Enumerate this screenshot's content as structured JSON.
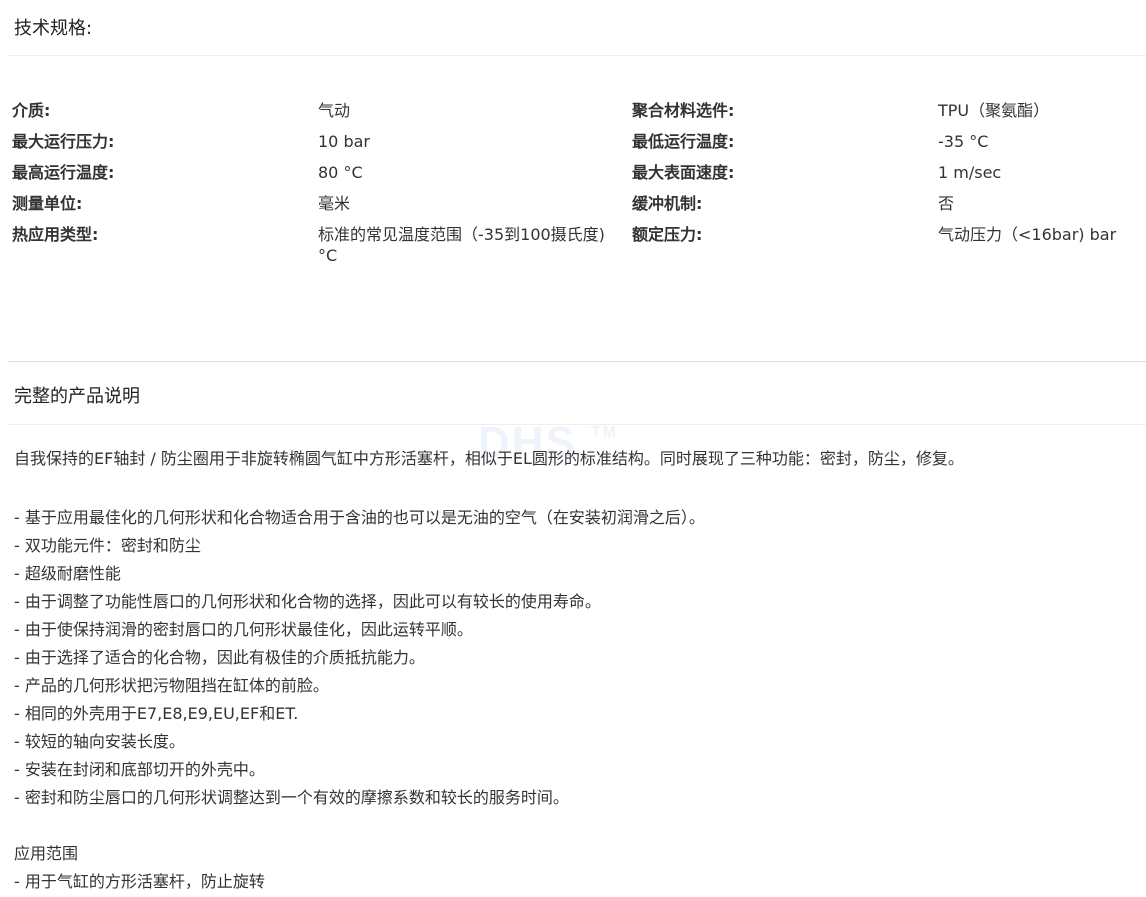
{
  "spec_section": {
    "title": "技术规格:",
    "rows": [
      {
        "label1": "介质:",
        "value1": "气动",
        "label2": "聚合材料选件:",
        "value2": "TPU（聚氨酯）"
      },
      {
        "label1": "最大运行压力:",
        "value1": "10 bar",
        "label2": "最低运行温度:",
        "value2": "-35 °C"
      },
      {
        "label1": "最高运行温度:",
        "value1": "80 °C",
        "label2": "最大表面速度:",
        "value2": "1 m/sec"
      },
      {
        "label1": "测量单位:",
        "value1": "毫米",
        "label2": "缓冲机制:",
        "value2": "否"
      },
      {
        "label1": "热应用类型:",
        "value1": "标准的常见温度范围（-35到100摄氏度) °C",
        "label2": "额定压力:",
        "value2": "气动压力（<16bar) bar"
      }
    ]
  },
  "watermark": {
    "text": "DHS",
    "tm": "TM"
  },
  "description": {
    "title": "完整的产品说明",
    "intro": "自我保持的EF轴封 / 防尘圈用于非旋转椭圆气缸中方形活塞杆，相似于EL圆形的标准结构。同时展现了三种功能：密封，防尘，修复。",
    "bullets": [
      " - 基于应用最佳化的几何形状和化合物适合用于含油的也可以是无油的空气（在安装初润滑之后）。",
      " - 双功能元件：密封和防尘",
      " - 超级耐磨性能",
      " - 由于调整了功能性唇口的几何形状和化合物的选择，因此可以有较长的使用寿命。",
      " - 由于使保持润滑的密封唇口的几何形状最佳化，因此运转平顺。",
      " - 由于选择了适合的化合物，因此有极佳的介质抵抗能力。",
      " - 产品的几何形状把污物阻挡在缸体的前脸。",
      " - 相同的外壳用于E7,E8,E9,EU,EF和ET.",
      " - 较短的轴向安装长度。",
      " - 安装在封闭和底部切开的外壳中。",
      " - 密封和防尘唇口的几何形状调整达到一个有效的摩擦系数和较长的服务时间。"
    ],
    "application_title": "应用范围",
    "application_items": [
      " - 用于气缸的方形活塞杆，防止旋转"
    ]
  }
}
